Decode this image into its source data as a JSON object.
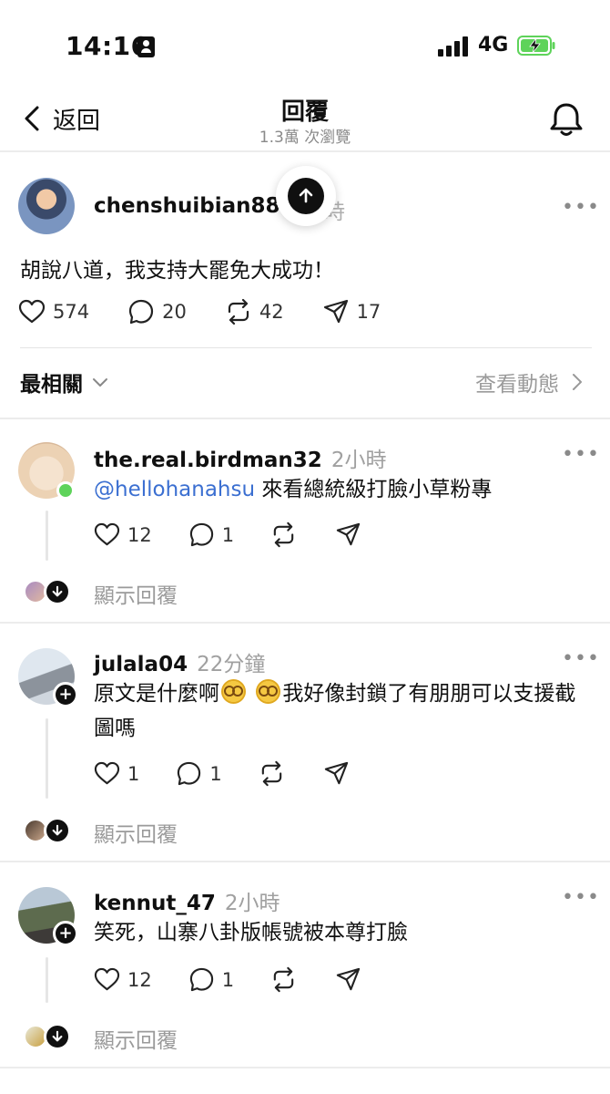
{
  "status_bar": {
    "time": "14:16",
    "network": "4G"
  },
  "header": {
    "back_label": "返回",
    "title": "回覆",
    "subtitle": "1.3萬 次瀏覽"
  },
  "post": {
    "username": "chenshuibian88",
    "time": "時",
    "more": "•••",
    "text": "胡說八道，我支持大罷免大成功！",
    "likes": "574",
    "comments": "20",
    "reposts": "42",
    "shares": "17"
  },
  "sort": {
    "label": "最相關",
    "activity_label": "查看動態"
  },
  "replies": [
    {
      "username": "the.real.birdman32",
      "time": "2小時",
      "mention": "@hellohanahsu",
      "text": " 來看總統級打臉小草粉專",
      "likes": "12",
      "comments": "1",
      "show_replies": "顯示回覆"
    },
    {
      "username": "julala04",
      "time": "22分鐘",
      "text_before": "原文是什麼啊",
      "text_after": "我好像封鎖了有朋朋可以支援截圖嗎",
      "likes": "1",
      "comments": "1",
      "show_replies": "顯示回覆"
    },
    {
      "username": "kennut_47",
      "time": "2小時",
      "text": "笑死，山寨八卦版帳號被本尊打臉",
      "likes": "12",
      "comments": "1",
      "show_replies": "顯示回覆"
    }
  ],
  "colors": {
    "accent_link": "#3b6fd1",
    "online": "#5ed35a",
    "battery": "#5ed35a"
  }
}
